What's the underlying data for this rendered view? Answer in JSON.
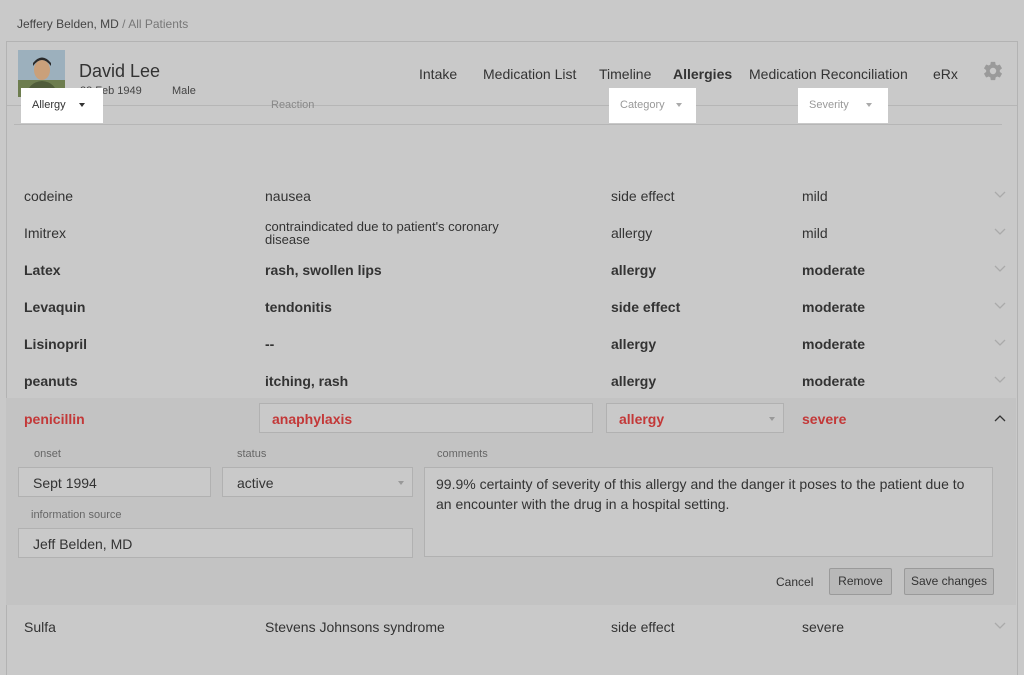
{
  "breadcrumb": {
    "user": "Jeffery Belden, MD",
    "separator": "/",
    "section": "All Patients"
  },
  "patient": {
    "name": "David Lee",
    "dob": "22 Feb 1949",
    "sex": "Male"
  },
  "nav": {
    "intake": "Intake",
    "medication_list": "Medication List",
    "timeline": "Timeline",
    "allergies": "Allergies",
    "med_reconciliation": "Medication Reconciliation",
    "erx": "eRx"
  },
  "columns": {
    "allergy": "Allergy",
    "reaction": "Reaction",
    "category": "Category",
    "severity": "Severity"
  },
  "rows": [
    {
      "allergy": "codeine",
      "reaction": "nausea",
      "category": "side effect",
      "severity": "mild"
    },
    {
      "allergy": "Imitrex",
      "reaction": "contraindicated due to patient's coronary disease",
      "category": "allergy",
      "severity": "mild"
    },
    {
      "allergy": "Latex",
      "reaction": "rash, swollen lips",
      "category": "allergy",
      "severity": "moderate"
    },
    {
      "allergy": "Levaquin",
      "reaction": "tendonitis",
      "category": "side effect",
      "severity": "moderate"
    },
    {
      "allergy": "Lisinopril",
      "reaction": "--",
      "category": "allergy",
      "severity": "moderate"
    },
    {
      "allergy": "peanuts",
      "reaction": "itching, rash",
      "category": "allergy",
      "severity": "moderate"
    }
  ],
  "expanded": {
    "allergy": "penicillin",
    "reaction": "anaphylaxis",
    "category": "allergy",
    "severity": "severe",
    "onset_label": "onset",
    "onset": "Sept 1994",
    "status_label": "status",
    "status": "active",
    "source_label": "information source",
    "source": "Jeff Belden, MD",
    "comments_label": "comments",
    "comments": "99.9% certainty of severity of this allergy and the danger it poses to the patient due to an encounter with the drug in a hospital setting.",
    "cancel": "Cancel",
    "remove": "Remove",
    "save": "Save changes"
  },
  "last_row": {
    "allergy": "Sulfa",
    "reaction": "Stevens Johnsons syndrome",
    "category": "side effect",
    "severity": "severe"
  },
  "colors": {
    "alert_red": "#c33838",
    "background": "#c9c9c9",
    "header_button": "#ffffff"
  }
}
